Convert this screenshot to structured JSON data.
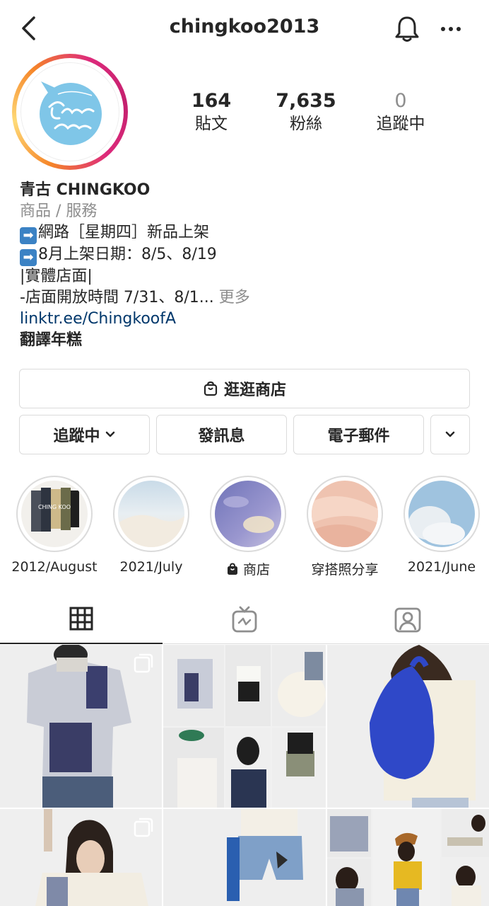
{
  "header": {
    "username": "chingkoo2013"
  },
  "profile": {
    "avatar_text": "Chingkoo",
    "stats": [
      {
        "value": "164",
        "label": "貼文"
      },
      {
        "value": "7,635",
        "label": "粉絲"
      },
      {
        "value": "0",
        "label": "追蹤中"
      }
    ]
  },
  "bio": {
    "name": "青古 CHINGKOO",
    "category": "商品 / 服務",
    "line1": "網路［星期四］新品上架",
    "line2": "8月上架日期：8/5、8/19",
    "line3": "|實體店面|",
    "line4": "-店面開放時間 7/31、8/1...",
    "more": "更多",
    "link": "linktr.ee/ChingkoofA",
    "translate": "翻譯年糕",
    "arrow_glyph": "➡"
  },
  "buttons": {
    "shop": "逛逛商店",
    "following": "追蹤中",
    "message": "發訊息",
    "email": "電子郵件"
  },
  "highlights": [
    {
      "label": "2012/August",
      "overlay": "CHING KOO"
    },
    {
      "label": "2021/July"
    },
    {
      "label": "商店"
    },
    {
      "label": "穿搭照分享"
    },
    {
      "label": "2021/June"
    }
  ],
  "colors": {
    "link": "#00376b",
    "muted": "#8e8e8e",
    "border": "#dbdbdb",
    "logo_blue": "#7fc6e8"
  }
}
